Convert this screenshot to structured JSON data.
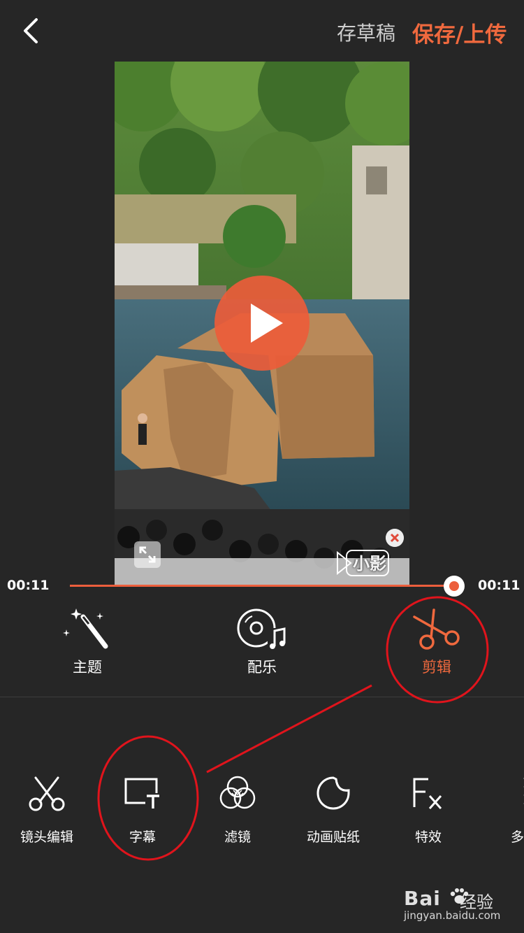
{
  "header": {
    "draft_label": "存草稿",
    "save_label": "保存/上传"
  },
  "video": {
    "watermark_label": "小影"
  },
  "timeline": {
    "current": "00:11",
    "total": "00:11",
    "progress": 1.0
  },
  "main_tools": [
    {
      "label": "主题",
      "icon": "magic-wand-icon"
    },
    {
      "label": "配乐",
      "icon": "music-disc-icon"
    },
    {
      "label": "剪辑",
      "icon": "scissors-icon",
      "active": true
    }
  ],
  "sub_tools": [
    {
      "label": "镜头编辑",
      "icon": "scissors-icon"
    },
    {
      "label": "字幕",
      "icon": "subtitle-icon"
    },
    {
      "label": "滤镜",
      "icon": "filter-icon"
    },
    {
      "label": "动画贴纸",
      "icon": "sticker-icon"
    },
    {
      "label": "特效",
      "icon": "fx-icon"
    },
    {
      "label": "多段",
      "icon": "multi-segment-icon"
    }
  ],
  "watermark": {
    "brand": "Bai",
    "brand2": "经验",
    "url": "jingyan.baidu.com"
  },
  "colors": {
    "accent": "#f0693e",
    "background": "#262626",
    "annotation": "#e0141c"
  }
}
